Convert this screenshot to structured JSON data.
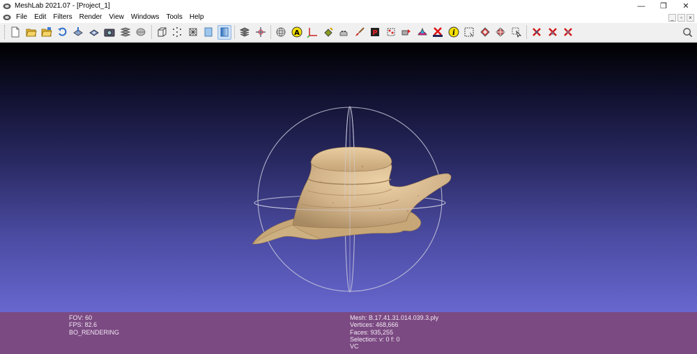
{
  "window": {
    "title": "MeshLab 2021.07 - [Project_1]",
    "minimize_glyph": "—",
    "restore_glyph": "❐",
    "close_glyph": "✕"
  },
  "menu": {
    "items": [
      "File",
      "Edit",
      "Filters",
      "Render",
      "View",
      "Windows",
      "Tools",
      "Help"
    ],
    "mdi_minimize": "_",
    "mdi_restore": "▫",
    "mdi_close": "×"
  },
  "toolbar": {
    "icons": [
      "new-project-icon",
      "open-project-icon",
      "open-mesh-icon",
      "reload-icon",
      "export-mesh-icon",
      "export-as-icon",
      "snapshot-icon",
      "show-layers-icon",
      "point-cloud-icon",
      "bounding-box-icon",
      "points-render-icon",
      "wireframe-icon",
      "flat-shade-icon",
      "smooth-shade-icon",
      "lighting-icon",
      "axes-pan-icon",
      "trackball-icon",
      "annotate-icon",
      "axis-icon",
      "paint-bucket-icon",
      "align-icon",
      "brush-icon",
      "pickpoints-icon",
      "select-vertices-icon",
      "manipulator-icon",
      "texture-paint-icon",
      "georef-icon",
      "info-icon",
      "select-rect-icon",
      "select-faces-icon",
      "select-connected-icon",
      "select-cursor-icon",
      "delete-vertices-icon",
      "delete-faces-icon",
      "delete-both-icon"
    ],
    "active_icon": "smooth-shade-icon"
  },
  "info": {
    "fov_label": "FOV: 60",
    "fps_label": "FPS:    82.6",
    "render_mode": "BO_RENDERING",
    "mesh_name": "Mesh: B.17.41.31.014.039.3.ply",
    "vertices": "Vertices: 468,666",
    "faces": "Faces: 935,255",
    "selection": "Selection: v: 0 f: 0",
    "color_mode": "VC"
  },
  "colors": {
    "infobar_bg": "#7b4a82",
    "viewport_top": "#000000",
    "viewport_bottom": "#6767cf",
    "mesh_fill": "#d3b48a",
    "trackball": "#c9c9dd",
    "delete_red": "#d01818"
  }
}
